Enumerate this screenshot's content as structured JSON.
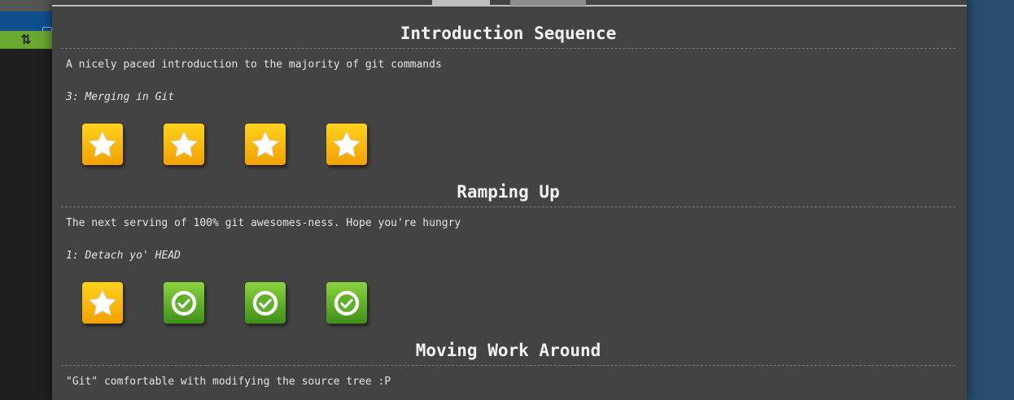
{
  "sidebar": {
    "edit_icon": "edit-icon",
    "sync_icon_glyph": "⇅"
  },
  "colors": {
    "panel_bg": "#434343",
    "star": "#ffc20e",
    "check": "#5fb02a",
    "accent_blue": "#0f4f8f"
  },
  "sequences": [
    {
      "title": "Introduction Sequence",
      "description": "A nicely paced introduction to the majority of git commands",
      "current_level": "3: Merging in Git",
      "levels": [
        "star",
        "star",
        "star",
        "star"
      ]
    },
    {
      "title": "Ramping Up",
      "description": "The next serving of 100% git awesomes-ness. Hope you're hungry",
      "current_level": "1: Detach yo' HEAD",
      "levels": [
        "star",
        "check",
        "check",
        "check"
      ]
    },
    {
      "title": "Moving Work Around",
      "description": "\"Git\" comfortable with modifying the source tree :P"
    }
  ]
}
